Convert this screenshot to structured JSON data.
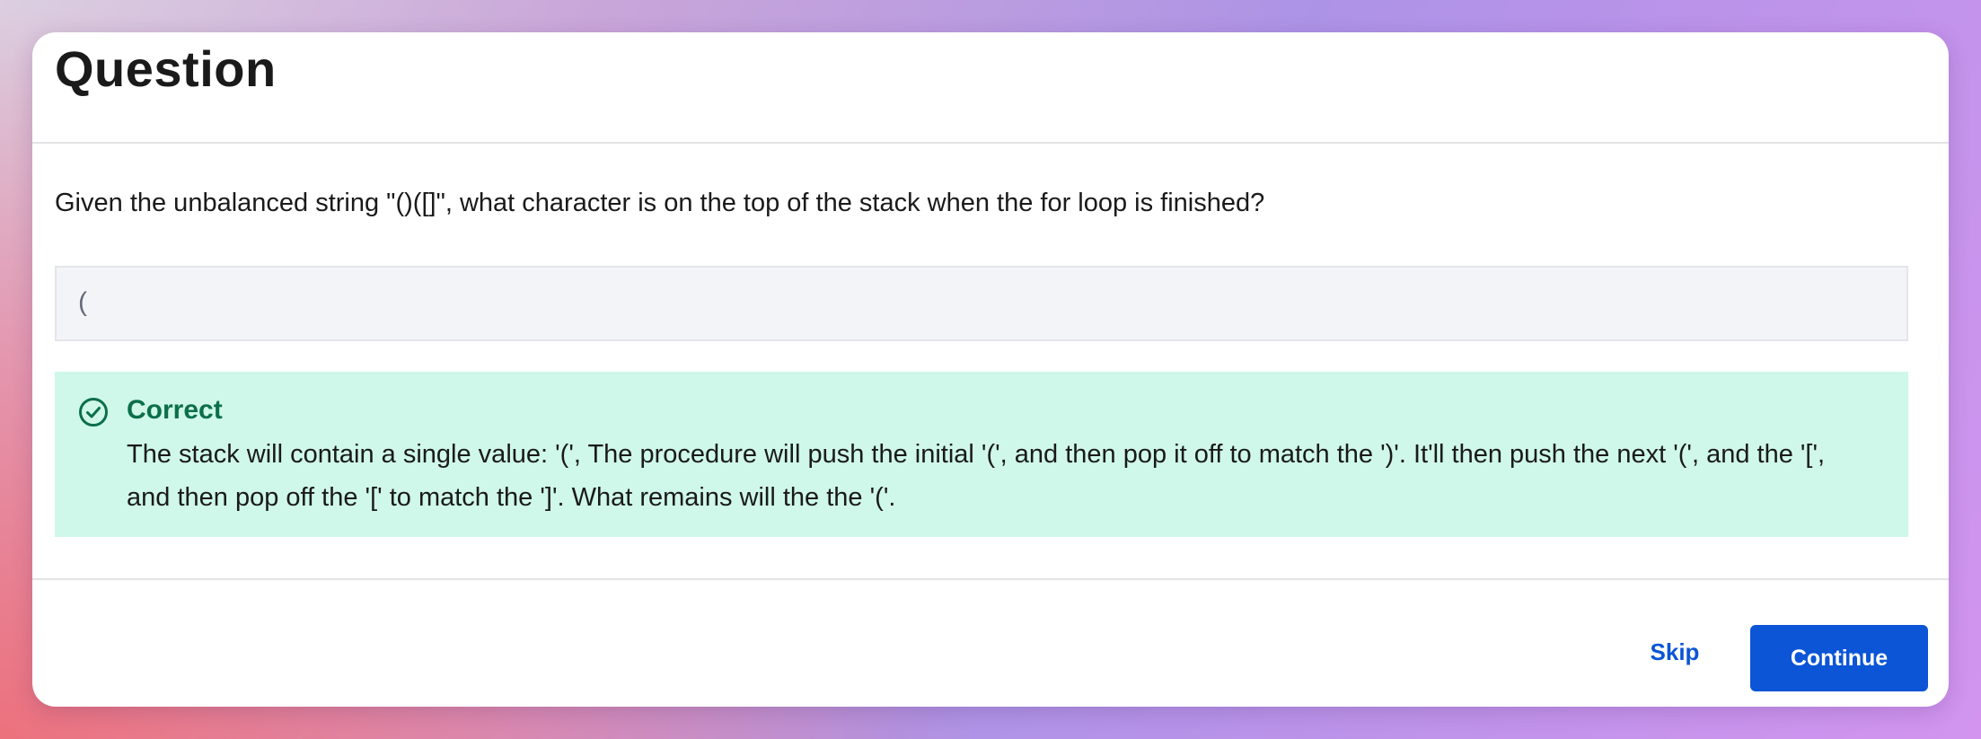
{
  "header": {
    "title": "Question"
  },
  "question": {
    "text": "Given the unbalanced string \"()([]\", what character is on the top of the stack when the for loop is finished?",
    "answer": "("
  },
  "feedback": {
    "status": "Correct",
    "icon": "check-circle-icon",
    "message": "The stack will contain a single value: '(', The procedure will push the initial '(', and then pop it off to match the ')'. It'll then push the next '(', and the '[', and then pop off the '[' to match the ']'.  What remains will the the '('."
  },
  "footer": {
    "skip_label": "Skip",
    "continue_label": "Continue"
  },
  "colors": {
    "accent": "#0b55d6",
    "success_bg": "#cff8ea",
    "success_text": "#0b6f4a"
  }
}
